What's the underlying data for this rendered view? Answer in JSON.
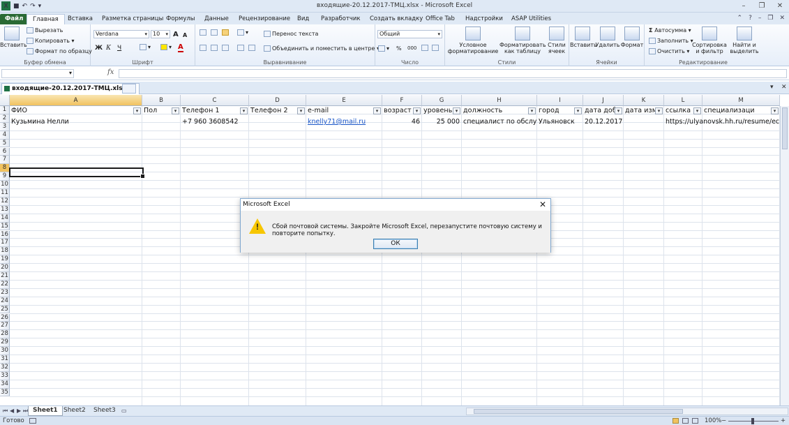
{
  "window": {
    "title": "входящие-20.12.2017-ТМЦ.xlsx - Microsoft Excel"
  },
  "ribbon_tabs": [
    "Файл",
    "Главная",
    "Вставка",
    "Разметка страницы",
    "Формулы",
    "Данные",
    "Рецензирование",
    "Вид",
    "Разработчик",
    "Создать вкладку",
    "Office Tab",
    "Надстройки",
    "ASAP Utilities"
  ],
  "clipboard": {
    "paste": "Вставить",
    "cut": "Вырезать",
    "copy": "Копировать",
    "format_painter": "Формат по образцу",
    "label": "Буфер обмена"
  },
  "font": {
    "name": "Verdana",
    "size": "10",
    "bold": "Ж",
    "italic": "К",
    "underline": "Ч",
    "grow": "A",
    "shrink": "A",
    "color_letter": "A",
    "label": "Шрифт"
  },
  "alignment": {
    "wrap": "Перенос текста",
    "merge": "Объединить и поместить в центре",
    "label": "Выравнивание"
  },
  "number": {
    "format": "Общий",
    "percent": "%",
    "thousands": "000",
    "label": "Число"
  },
  "styles": {
    "conditional": "Условное форматирование",
    "table": "Форматировать как таблицу",
    "cell": "Стили ячеек",
    "label": "Стили"
  },
  "cells": {
    "insert": "Вставить",
    "delete": "Удалить",
    "format": "Формат",
    "label": "Ячейки"
  },
  "editing": {
    "autosum": "Автосумма",
    "fill": "Заполнить",
    "clear": "Очистить",
    "sort": "Сортировка и фильтр",
    "find": "Найти и выделить",
    "label": "Редактирование"
  },
  "formula_bar": {
    "fx": "fx",
    "name_box": "",
    "value": ""
  },
  "doc_tab": {
    "name": "входящие-20.12.2017-ТМЦ.xlsx",
    "close": "×"
  },
  "columns": [
    "A",
    "B",
    "C",
    "D",
    "E",
    "F",
    "G",
    "H",
    "I",
    "J",
    "K",
    "L",
    "M"
  ],
  "headers": [
    "ФИО",
    "Пол",
    "Телефон 1",
    "Телефон 2",
    "e-mail",
    "возраст",
    "уровень",
    "должность",
    "город",
    "дата доб",
    "дата изм",
    "ссылка",
    "специализаци"
  ],
  "row2": {
    "fio": "Кузьмина Нелли",
    "pol": "",
    "phone1": "+7 960 3608542",
    "phone2": "",
    "email": "knelly71@mail.ru",
    "age": "46",
    "level": "25 000",
    "position": "специалист по обслу:",
    "city": "Ульяновск",
    "date_added": "20.12.2017",
    "date_changed": "",
    "link": "https://ulyanovsk.hh.ru/resume/ec",
    "spec": ""
  },
  "row_numbers": [
    "1",
    "2",
    "3",
    "4",
    "5",
    "6",
    "7",
    "8",
    "9",
    "10",
    "11",
    "12",
    "13",
    "14",
    "15",
    "16",
    "17",
    "18",
    "19",
    "20",
    "21",
    "22",
    "23",
    "24",
    "25",
    "26",
    "27",
    "28",
    "29",
    "30",
    "31",
    "32",
    "33",
    "34",
    "35"
  ],
  "sheets": [
    "Sheet1",
    "Sheet2",
    "Sheet3"
  ],
  "status": {
    "ready": "Готово",
    "zoom": "100%"
  },
  "dialog": {
    "title": "Microsoft Excel",
    "message": "Сбой почтовой системы. Закройте Microsoft Excel, перезапустите почтовую систему и повторите попытку.",
    "ok": "ОК",
    "close": "✕",
    "icon": "!"
  },
  "colors": {
    "accent": "#2a6a34",
    "selection": "#f1c25f",
    "link": "#1a56c8"
  }
}
